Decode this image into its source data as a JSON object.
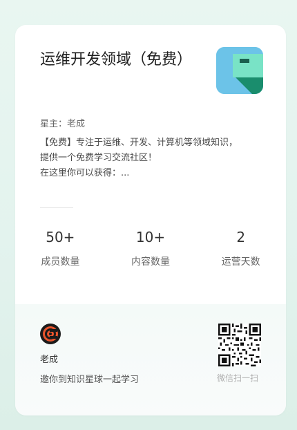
{
  "card": {
    "title": "运维开发领域（免费）",
    "owner": "星主：老成",
    "description_lines": [
      "【免费】专注于运维、开发、计算机等领域知识，",
      "提供一个免费学习交流社区！",
      "在这里你可以获得：..."
    ]
  },
  "stats": [
    {
      "value": "50+",
      "label": "成员数量"
    },
    {
      "value": "10+",
      "label": "内容数量"
    },
    {
      "value": "2",
      "label": "运营天数"
    }
  ],
  "footer": {
    "author": "老成",
    "invite": "邀你到知识星球一起学习",
    "qr_label": "微信扫一扫"
  },
  "icons": {
    "logo": "planet-logo-icon",
    "avatar": "author-avatar-icon",
    "qr": "qr-code-icon"
  },
  "colors": {
    "logo_bg": "#6cc3e8",
    "logo_accent": "#79e3c6",
    "logo_dark": "#1a8d6d"
  }
}
